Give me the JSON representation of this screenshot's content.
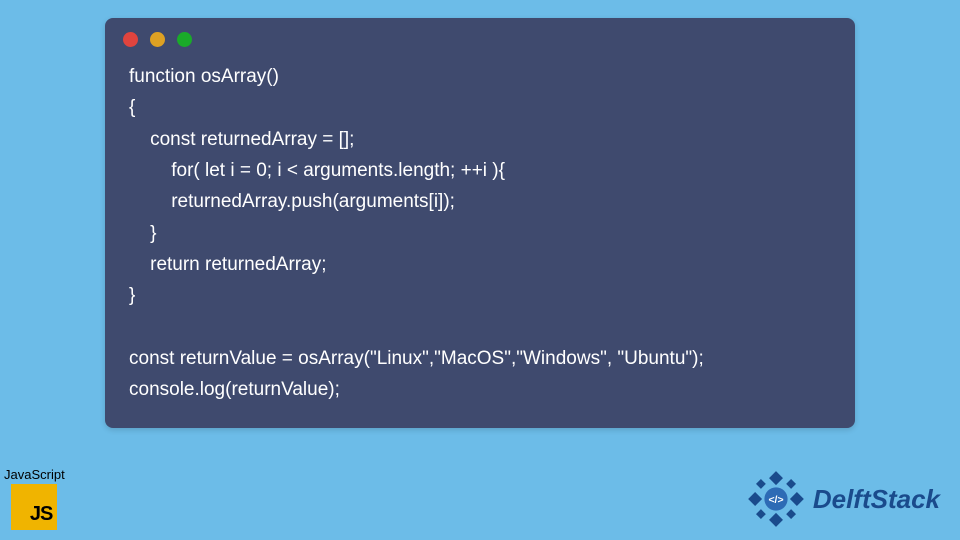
{
  "window": {
    "dots": [
      "red",
      "yellow",
      "green"
    ]
  },
  "code": {
    "lines": [
      "function osArray()",
      "{",
      "    const returnedArray = [];",
      "        for( let i = 0; i < arguments.length; ++i ){",
      "        returnedArray.push(arguments[i]);",
      "    }",
      "    return returnedArray;",
      "}",
      "",
      "const returnValue = osArray(\"Linux\",\"MacOS\",\"Windows\", \"Ubuntu\");",
      "console.log(returnValue);"
    ]
  },
  "badge": {
    "label": "JavaScript",
    "logo_text": "JS"
  },
  "brand": {
    "name": "DelftStack"
  },
  "colors": {
    "background": "#6cbce8",
    "window_bg": "#3f4a6e",
    "code_text": "#ffffff",
    "js_logo_bg": "#f0b400",
    "brand_color": "#1a4b8c"
  }
}
